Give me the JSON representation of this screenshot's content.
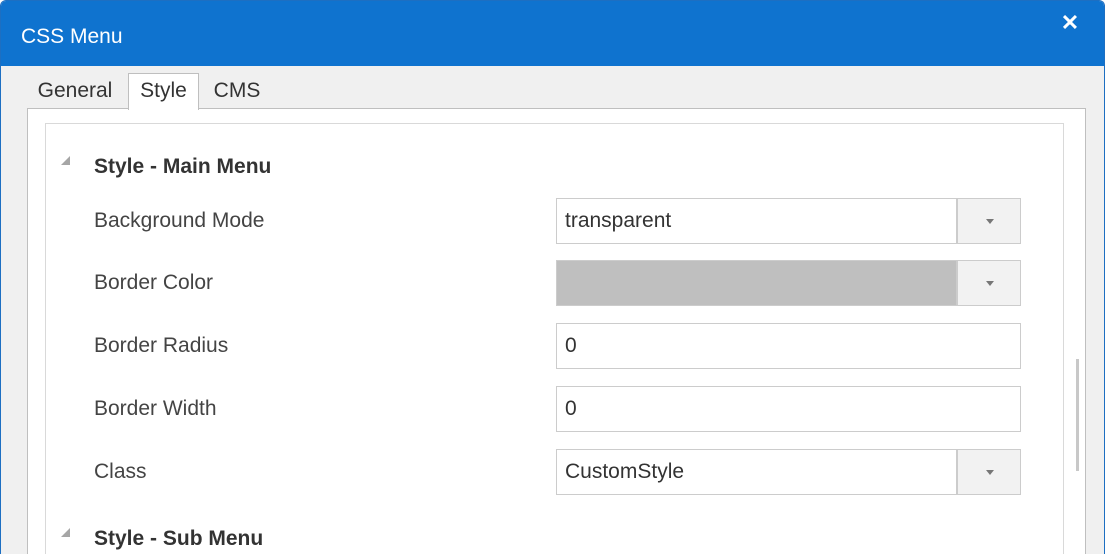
{
  "window": {
    "title": "CSS Menu",
    "close_label": "✕"
  },
  "tabs": [
    {
      "label": "General",
      "selected": false
    },
    {
      "label": "Style",
      "selected": true
    },
    {
      "label": "CMS",
      "selected": false
    }
  ],
  "sections": {
    "main_menu": {
      "label": "Style - Main Menu",
      "expanded": true
    },
    "sub_menu": {
      "label": "Style - Sub Menu",
      "expanded": true
    }
  },
  "properties": {
    "background_mode": {
      "label": "Background Mode",
      "value": "transparent"
    },
    "border_color": {
      "label": "Border Color",
      "value": "",
      "color": "#bfbfbf"
    },
    "border_radius": {
      "label": "Border Radius",
      "value": "0"
    },
    "border_width": {
      "label": "Border Width",
      "value": "0"
    },
    "class": {
      "label": "Class",
      "value": "CustomStyle"
    }
  },
  "colors": {
    "title_bar": "#0f73cf",
    "border": "#1d6fc2"
  }
}
